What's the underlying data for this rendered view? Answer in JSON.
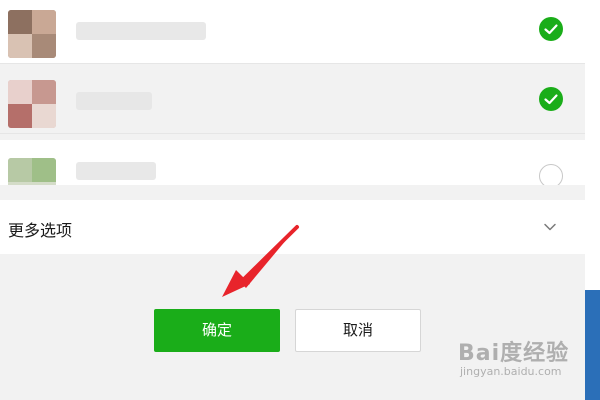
{
  "contacts": [
    {
      "selected": true
    },
    {
      "selected": true
    },
    {
      "selected": false
    }
  ],
  "more_options": {
    "label": "更多选项"
  },
  "buttons": {
    "confirm_label": "确定",
    "cancel_label": "取消"
  },
  "watermark": {
    "main": "Bai度经验",
    "sub": "jingyan.baidu.com"
  },
  "colors": {
    "accent": "#1aad19",
    "annotation_arrow": "#e8242b"
  },
  "icons": [
    "check-circle-icon",
    "empty-circle-icon",
    "chevron-down-icon",
    "arrow-annotation"
  ]
}
